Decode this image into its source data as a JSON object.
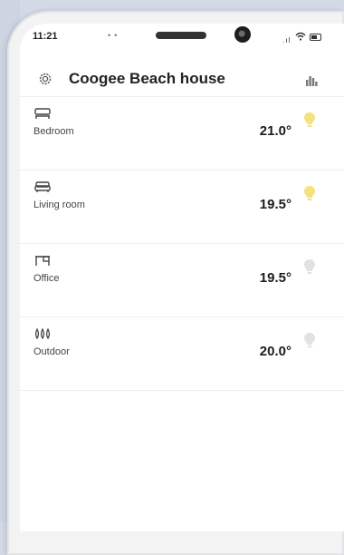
{
  "status_bar": {
    "time": "11:21"
  },
  "header": {
    "title": "Coogee Beach house"
  },
  "rooms": [
    {
      "name": "Bedroom",
      "temperature": "21.0°",
      "icon": "bed-icon",
      "light_on": true
    },
    {
      "name": "Living room",
      "temperature": "19.5°",
      "icon": "sofa-icon",
      "light_on": true
    },
    {
      "name": "Office",
      "temperature": "19.5°",
      "icon": "desk-icon",
      "light_on": false
    },
    {
      "name": "Outdoor",
      "temperature": "20.0°",
      "icon": "plants-icon",
      "light_on": false
    }
  ],
  "colors": {
    "light_on": "#f6e27c",
    "light_off": "#e2e2e4",
    "text_primary": "#1c1c1c",
    "divider": "#efefef",
    "background": "#d3d9e5"
  }
}
